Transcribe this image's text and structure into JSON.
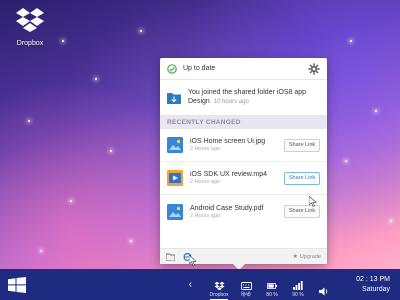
{
  "desktop": {
    "dropbox_label": "Dropbox"
  },
  "panel": {
    "status_text": "Up to date",
    "notification": {
      "text": "You joined the shared folder iOS8 app Design",
      "time": "10 hours ago"
    },
    "section_title": "RECENTLY CHANGED",
    "files": [
      {
        "name": "iOS Home screen Ui.jpg",
        "time": "2 Hours ago",
        "button": "Share Link",
        "thumb_color": "#3a86d6"
      },
      {
        "name": "iOS SDK UX review.mp4",
        "time": "2 Hours ago",
        "button": "Share Link",
        "thumb_color": "#2f74c9"
      },
      {
        "name": "Android Case Study.pdf",
        "time": "2 Hours ago",
        "button": "Share Link",
        "thumb_color": "#3a86d6"
      }
    ],
    "footer": {
      "upgrade_label": "Upgrade"
    }
  },
  "taskbar": {
    "chevron": "‹",
    "tray": {
      "dropbox": "Dropbox",
      "keyboard": "हिन्दी",
      "battery": "80 %",
      "signal": "90 %"
    },
    "clock_time": "02 : 13 PM",
    "clock_day": "Saturday"
  },
  "colors": {
    "taskbar": "#1e2b80",
    "accent_blue": "#2b7cc1",
    "status_green": "#4caf50"
  }
}
